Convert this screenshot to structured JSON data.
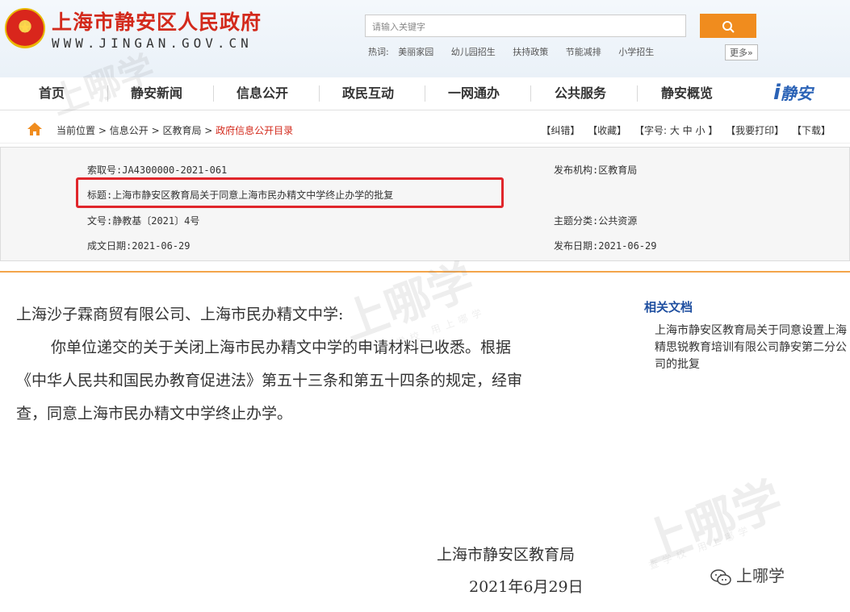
{
  "header": {
    "title": "上海市静安区人民政府",
    "url": "WWW.JINGAN.GOV.CN",
    "search_placeholder": "请输入关键字",
    "hot_label": "热词:",
    "hot_words": [
      "美丽家园",
      "幼儿园招生",
      "扶持政策",
      "节能减排",
      "小学招生"
    ],
    "more_label": "更多»"
  },
  "nav": {
    "items": [
      "首页",
      "静安新闻",
      "信息公开",
      "政民互动",
      "一网通办",
      "公共服务",
      "静安概览"
    ],
    "logo_text": "静安"
  },
  "breadcrumb": {
    "current_label": "当前位置",
    "path1": "信息公开",
    "path2": "区教育局",
    "current": "政府信息公开目录"
  },
  "tools": [
    "【纠错】",
    "【收藏】",
    "【字号: 大 中 小 】",
    "【我要打印】",
    "【下载】"
  ],
  "meta": {
    "index_no": "索取号:JA4300000-2021-061",
    "publisher": "发布机构:区教育局",
    "title": "标题:上海市静安区教育局关于同意上海市民办精文中学终止办学的批复",
    "doc_no": "文号:静教基〔2021〕4号",
    "category": "主题分类:公共资源",
    "created": "成文日期:2021-06-29",
    "published": "发布日期:2021-06-29"
  },
  "body": {
    "salutation": "上海沙子霖商贸有限公司、上海市民办精文中学:",
    "para1": "你单位递交的关于关闭上海市民办精文中学的申请材料已收悉。根据",
    "para2": "《中华人民共和国民办教育促进法》第五十三条和第五十四条的规定，经审",
    "para3": "查，同意上海市民办精文中学终止办学。",
    "signer": "上海市静安区教育局",
    "date": "2021年6月29日"
  },
  "related": {
    "title": "相关文档",
    "items": [
      "上海市静安区教育局关于同意设置上海精思锐教育培训有限公司静安第二分公司的批复"
    ]
  },
  "watermark": {
    "text": "上哪学",
    "sub": "查学校 用上哪学",
    "wechat_label": "上哪学"
  },
  "colors": {
    "brand_red": "#d32a1c",
    "search_orange": "#f08c1e",
    "highlight_red": "#e0262b",
    "link_blue": "#1f4fa0"
  }
}
